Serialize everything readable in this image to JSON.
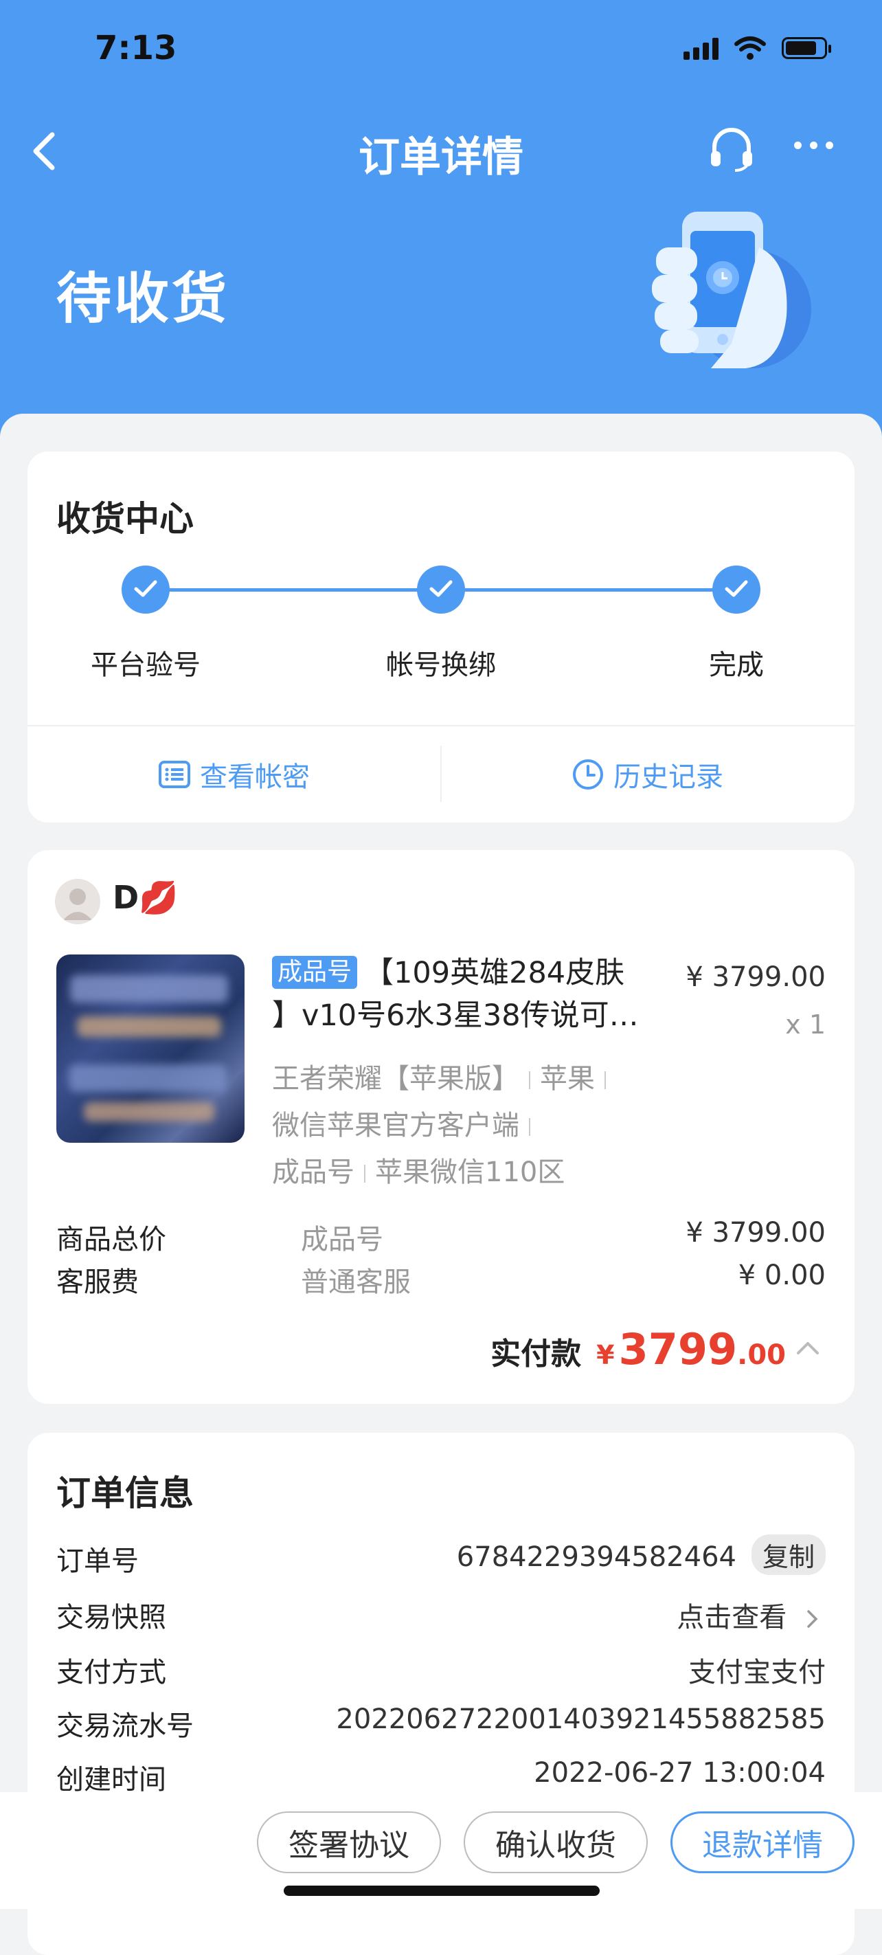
{
  "status_bar": {
    "time": "7:13"
  },
  "nav": {
    "title": "订单详情"
  },
  "order_status": "待收货",
  "colors": {
    "accent": "#4e9bf4",
    "price": "#e8402f"
  },
  "receive_center": {
    "title": "收货中心",
    "steps": [
      {
        "label": "平台验号",
        "done": true
      },
      {
        "label": "帐号换绑",
        "done": true
      },
      {
        "label": "完成",
        "done": true
      }
    ],
    "actions": [
      {
        "label": "查看帐密",
        "icon": "list-icon"
      },
      {
        "label": "历史记录",
        "icon": "clock-icon"
      }
    ]
  },
  "product": {
    "seller_name": "D💋",
    "tag": "成品号",
    "title_line1": "【109英雄284皮肤",
    "title_line2": "】v10号6水3星38传说可…",
    "price": "¥ 3799.00",
    "qty": "x 1",
    "meta": {
      "game": "王者荣耀【苹果版】",
      "platform": "苹果",
      "client": "微信苹果官方客户端",
      "type": "成品号",
      "server": "苹果微信110区"
    },
    "fees": [
      {
        "label": "商品总价",
        "type": "成品号",
        "value": "¥ 3799.00"
      },
      {
        "label": "客服费",
        "type": "普通客服",
        "value": "¥ 0.00"
      }
    ],
    "paid": {
      "label": "实付款",
      "currency": "¥",
      "integer": "3799",
      "decimal": ".00"
    }
  },
  "order_info": {
    "title": "订单信息",
    "order_no_label": "订单号",
    "order_no": "6784229394582464",
    "copy_label": "复制",
    "snapshot_label": "交易快照",
    "snapshot_value": "点击查看",
    "payment_label": "支付方式",
    "payment_value": "支付宝支付",
    "serial_label": "交易流水号",
    "serial_value": "20220627220014039214558825​85",
    "created_label": "创建时间",
    "created_value": "2022-06-27 13:00:04"
  },
  "bottom_buttons": {
    "sign": "签署协议",
    "confirm": "确认收货",
    "refund": "退款详情"
  }
}
